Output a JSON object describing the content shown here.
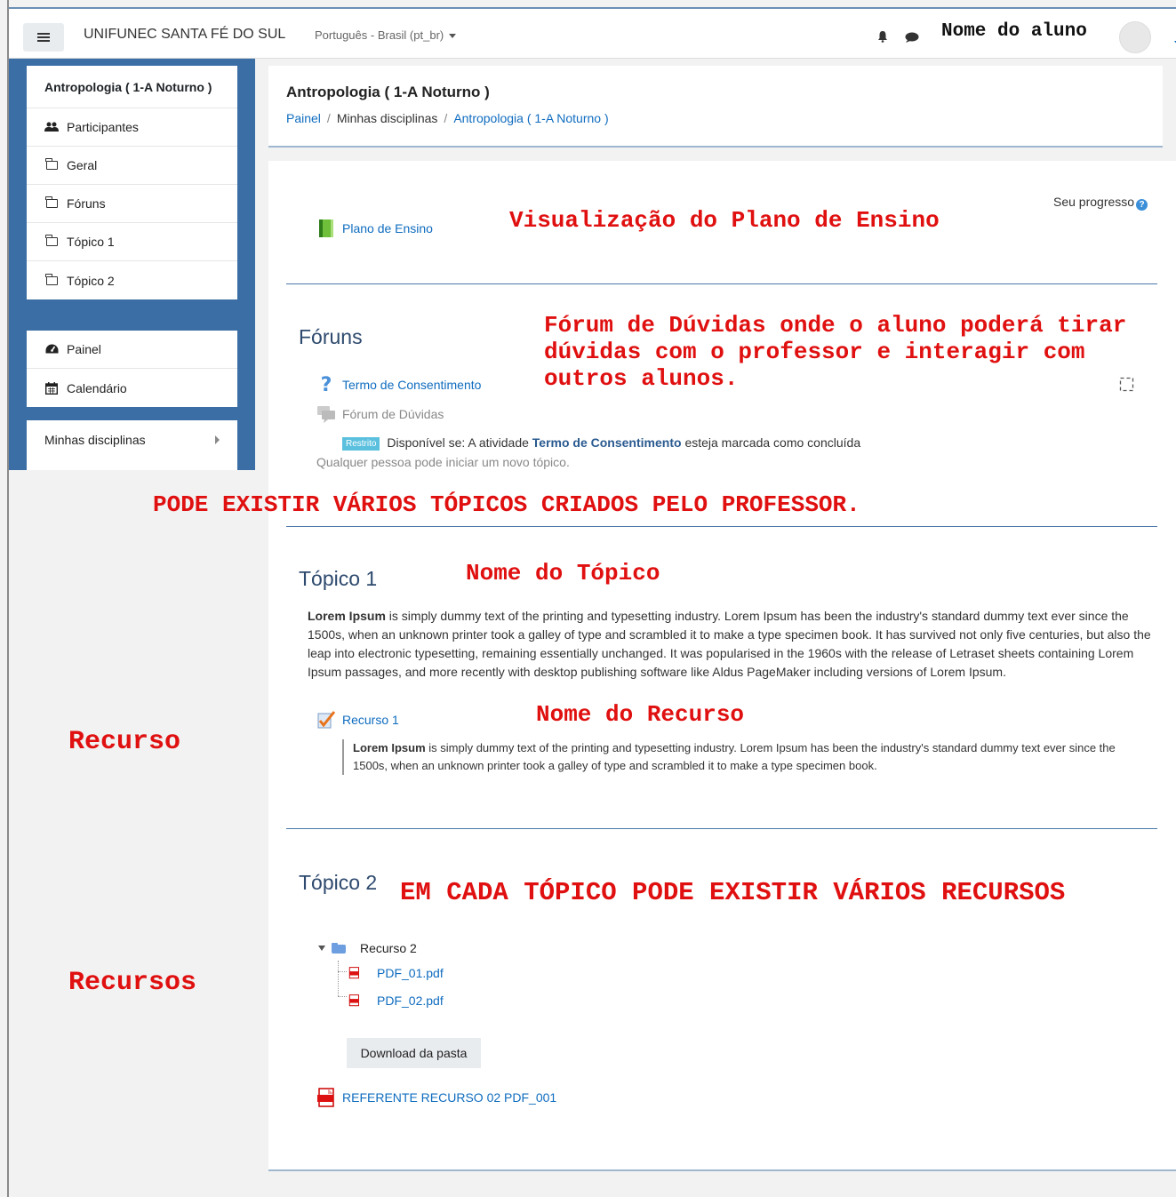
{
  "navbar": {
    "site_name": "UNIFUNEC SANTA FÉ DO SUL",
    "language": "Português - Brasil (pt_br)",
    "username": "Nome do aluno"
  },
  "sidebar": {
    "course_title": "Antropologia ( 1-A Noturno )",
    "course_items": [
      {
        "label": "Participantes",
        "icon": "users-icon"
      },
      {
        "label": "Geral",
        "icon": "folder-icon"
      },
      {
        "label": "Fóruns",
        "icon": "folder-icon"
      },
      {
        "label": "Tópico 1",
        "icon": "folder-icon"
      },
      {
        "label": "Tópico 2",
        "icon": "folder-icon"
      }
    ],
    "nav_items": [
      {
        "label": "Painel",
        "icon": "dashboard-icon"
      },
      {
        "label": "Calendário",
        "icon": "calendar-icon"
      }
    ],
    "my_courses": "Minhas disciplinas"
  },
  "header": {
    "title": "Antropologia ( 1-A Noturno )",
    "breadcrumb": [
      "Painel",
      "Minhas disciplinas",
      "Antropologia ( 1-A Noturno )"
    ]
  },
  "progress_label": "Seu progresso",
  "general": {
    "activity": "Plano de Ensino"
  },
  "forums": {
    "title": "Fóruns",
    "activity1": "Termo de Consentimento",
    "activity2": "Fórum de Dúvidas",
    "restricted_badge": "Restrito",
    "availability_prefix": "Disponível se: A atividade",
    "availability_activity": "Termo de Consentimento",
    "availability_suffix": "esteja marcada como concluída",
    "anyone_text": "Qualquer pessoa pode iniciar um novo tópico."
  },
  "topic1": {
    "title": "Tópico 1",
    "summary_bold": "Lorem Ipsum",
    "summary": "is simply dummy text of the printing and typesetting industry. Lorem Ipsum has been the industry's standard dummy text ever since the 1500s, when an unknown printer took a galley of type and scrambled it to make a type specimen book. It has survived not only five centuries, but also the leap into electronic typesetting, remaining essentially unchanged. It was popularised in the 1960s with the release of Letraset sheets containing Lorem Ipsum passages, and more recently with desktop publishing software like Aldus PageMaker including versions of Lorem Ipsum.",
    "resource": "Recurso 1",
    "resource_desc_bold": "Lorem Ipsum",
    "resource_desc": "is simply dummy text of the printing and typesetting industry. Lorem Ipsum has been the industry's standard dummy text ever since the 1500s, when an unknown printer took a galley of type and scrambled it to make a type specimen book."
  },
  "topic2": {
    "title": "Tópico 2",
    "folder": "Recurso 2",
    "files": [
      "PDF_01.pdf",
      "PDF_02.pdf"
    ],
    "download_button": "Download da pasta",
    "file_resource": "REFERENTE RECURSO 02 PDF_001"
  },
  "annotations": {
    "plano": "Visualização do Plano de Ensino",
    "forum": "Fórum de Dúvidas onde o aluno poderá tirar dúvidas com o professor e interagir com outros alunos.",
    "topicos": "PODE EXISTIR VÁRIOS TÓPICOS CRIADOS PELO PROFESSOR.",
    "nome_topico": "Nome do Tópico",
    "nome_recurso": "Nome do Recurso",
    "recurso": "Recurso",
    "varios_recursos": "EM CADA TÓPICO PODE EXISTIR VÁRIOS RECURSOS",
    "recursos": "Recursos"
  },
  "colors": {
    "sidebar_blue": "#3a6ea5",
    "link_blue": "#0f6cbf",
    "annotation_red": "#e01010",
    "badge_cyan": "#5bc0de"
  }
}
